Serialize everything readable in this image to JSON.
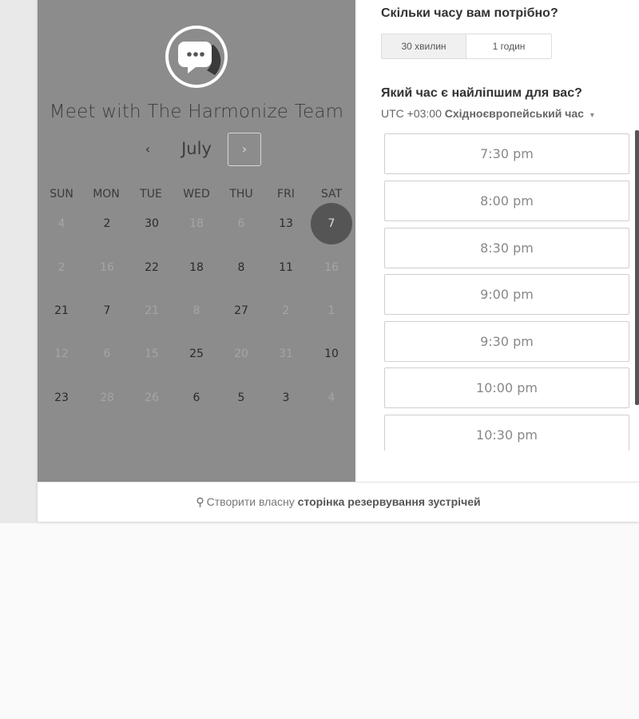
{
  "meeting": {
    "title": "Meet with The Harmonize Team",
    "avatar_icon": "chat-bubble-icon"
  },
  "calendar": {
    "month": "July",
    "prev_symbol": "‹",
    "next_symbol": "›",
    "weekdays": [
      "SUN",
      "MON",
      "TUE",
      "WED",
      "THU",
      "FRI",
      "SAT"
    ],
    "weeks": [
      [
        {
          "d": "4",
          "s": "disabled"
        },
        {
          "d": "2",
          "s": "available"
        },
        {
          "d": "30",
          "s": "available"
        },
        {
          "d": "18",
          "s": "disabled"
        },
        {
          "d": "6",
          "s": "disabled"
        },
        {
          "d": "13",
          "s": "available"
        },
        {
          "d": "7",
          "s": "selected"
        }
      ],
      [
        {
          "d": "2",
          "s": "disabled"
        },
        {
          "d": "16",
          "s": "disabled"
        },
        {
          "d": "22",
          "s": "available"
        },
        {
          "d": "18",
          "s": "available"
        },
        {
          "d": "8",
          "s": "available"
        },
        {
          "d": "11",
          "s": "available"
        },
        {
          "d": "16",
          "s": "disabled"
        }
      ],
      [
        {
          "d": "21",
          "s": "available"
        },
        {
          "d": "7",
          "s": "available"
        },
        {
          "d": "21",
          "s": "disabled"
        },
        {
          "d": "8",
          "s": "disabled"
        },
        {
          "d": "27",
          "s": "available"
        },
        {
          "d": "2",
          "s": "disabled"
        },
        {
          "d": "1",
          "s": "disabled"
        }
      ],
      [
        {
          "d": "12",
          "s": "disabled"
        },
        {
          "d": "6",
          "s": "disabled"
        },
        {
          "d": "15",
          "s": "disabled"
        },
        {
          "d": "25",
          "s": "available"
        },
        {
          "d": "20",
          "s": "disabled"
        },
        {
          "d": "31",
          "s": "disabled"
        },
        {
          "d": "10",
          "s": "available"
        }
      ],
      [
        {
          "d": "23",
          "s": "available"
        },
        {
          "d": "28",
          "s": "disabled"
        },
        {
          "d": "26",
          "s": "disabled"
        },
        {
          "d": "6",
          "s": "available"
        },
        {
          "d": "5",
          "s": "available"
        },
        {
          "d": "3",
          "s": "available"
        },
        {
          "d": "4",
          "s": "disabled"
        }
      ]
    ]
  },
  "duration": {
    "heading": "Скільки часу вам потрібно?",
    "options": [
      {
        "label": "30 хвилин",
        "selected": true
      },
      {
        "label": "1 годин",
        "selected": false
      }
    ]
  },
  "time_selection": {
    "heading": "Який час є найліпшим для вас?",
    "timezone_offset": "UTC +03:00",
    "timezone_name": "Східноєвропейський час",
    "slots": [
      "7:30 pm",
      "8:00 pm",
      "8:30 pm",
      "9:00 pm",
      "9:30 pm",
      "10:00 pm",
      "10:30 pm"
    ]
  },
  "footer": {
    "text": "Створити власну",
    "link": "сторінка резервування зустрічей",
    "icon": "hubspot-sprocket-icon"
  },
  "colors": {
    "left_panel": "#8c8c8c",
    "selected_day": "#555555"
  }
}
